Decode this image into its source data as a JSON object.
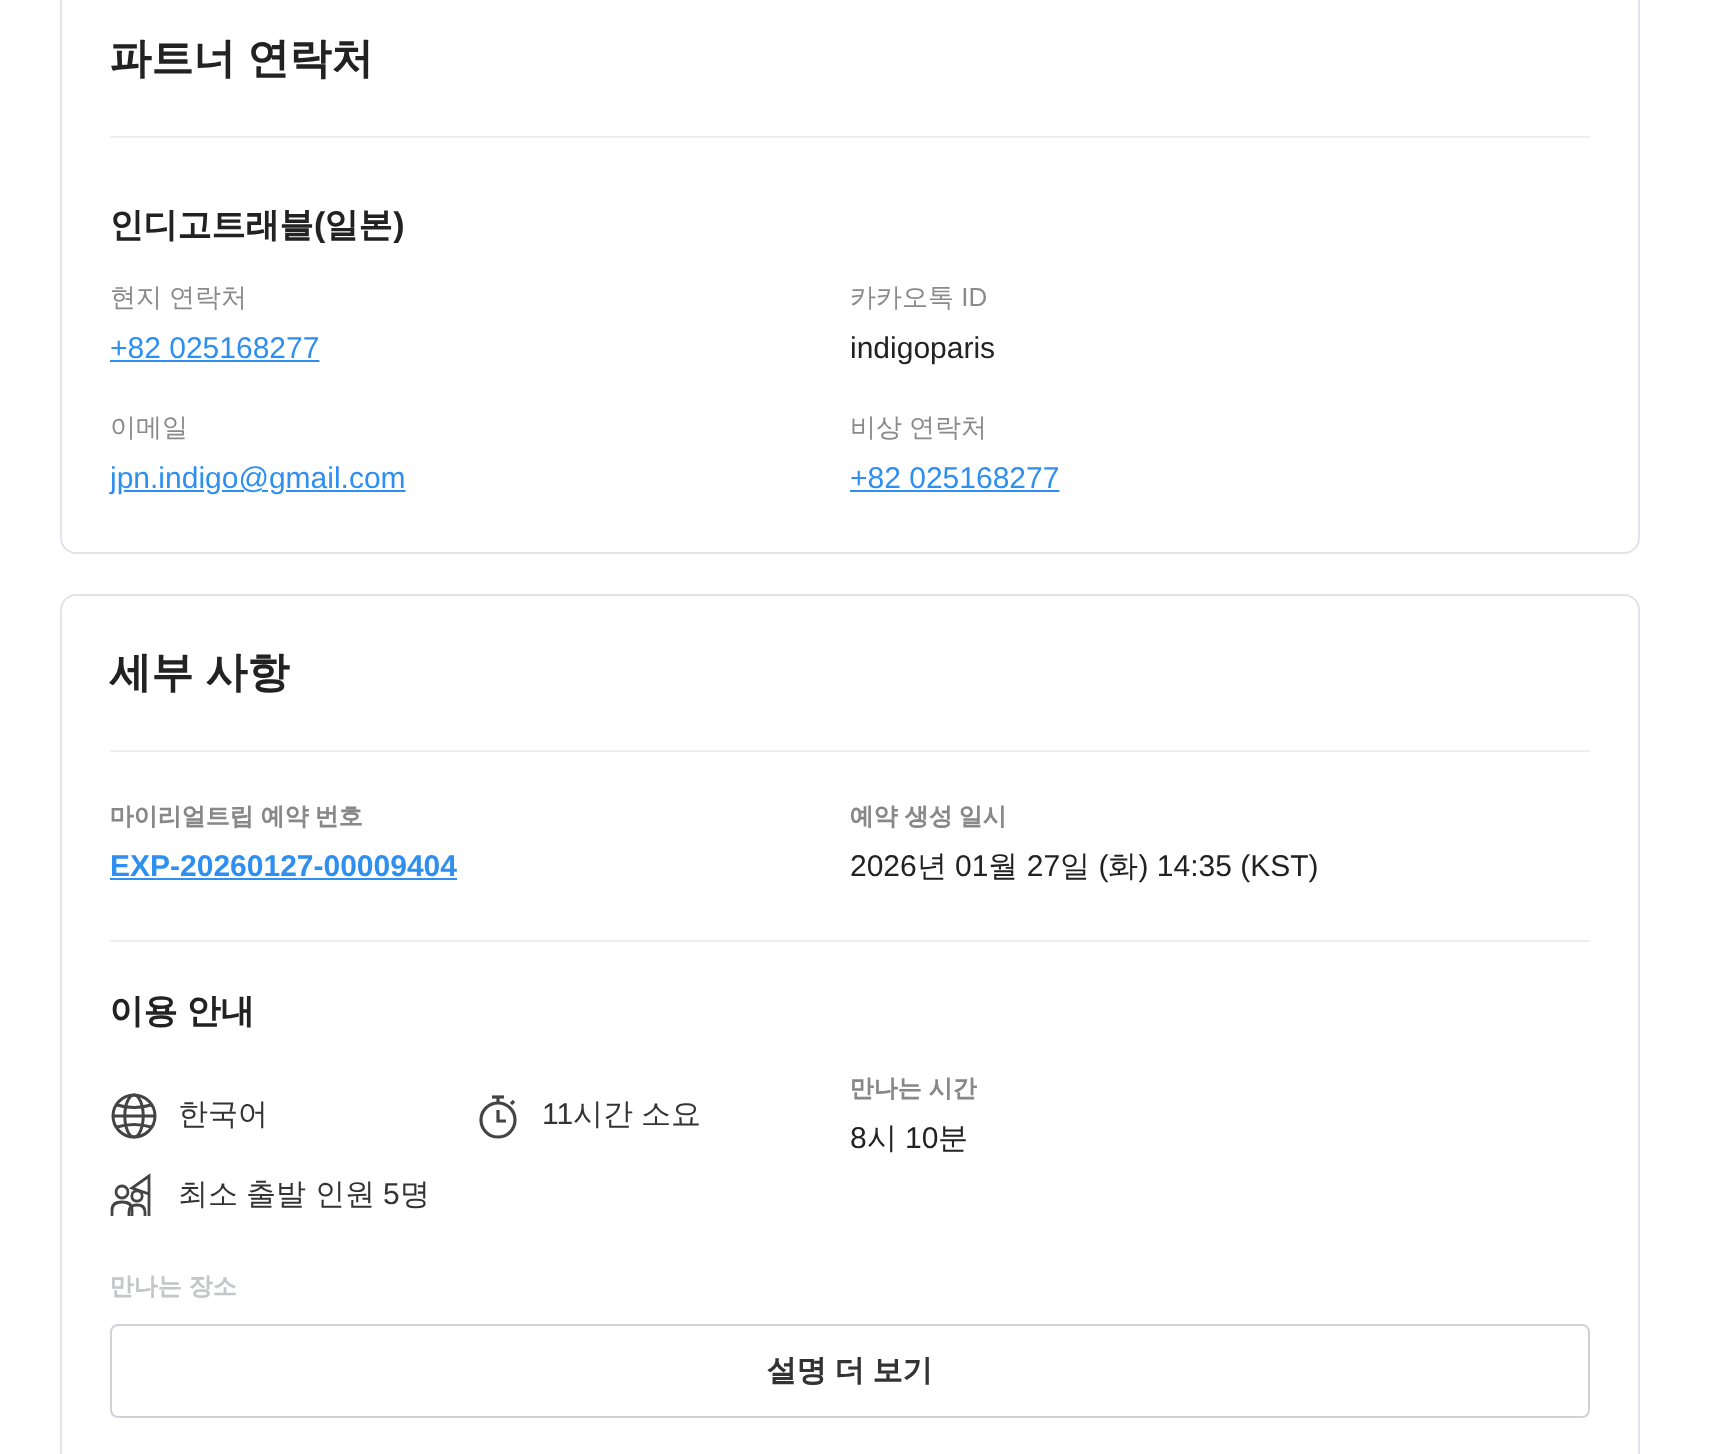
{
  "partner_contacts": {
    "title": "파트너 연락처",
    "partner_name": "인디고트래블(일본)",
    "fields": [
      {
        "label": "현지 연락처",
        "value": "+82 025168277",
        "kind": "link"
      },
      {
        "label": "카카오톡 ID",
        "value": "indigoparis",
        "kind": "text"
      },
      {
        "label": "이메일",
        "value": "jpn.indigo@gmail.com",
        "kind": "link"
      },
      {
        "label": "비상 연락처",
        "value": "+82 025168277",
        "kind": "link"
      }
    ]
  },
  "details": {
    "title": "세부 사항",
    "fields": [
      {
        "label": "마이리얼트립 예약 번호",
        "value": "EXP-20260127-00009404",
        "kind": "booking_link"
      },
      {
        "label": "예약 생성 일시",
        "value": "2026년 01월 27일 (화) 14:35 (KST)",
        "kind": "text"
      }
    ],
    "usage_guide": {
      "title": "이용 안내",
      "items": [
        {
          "kind": "language",
          "text": "한국어"
        },
        {
          "kind": "duration",
          "text": "11시간 소요"
        },
        {
          "kind": "min_people",
          "text": "최소 출발 인원 5명"
        }
      ],
      "meeting_time": {
        "label": "만나는 시간",
        "value": "8시 10분"
      },
      "meeting_place": {
        "label": "만나는 장소",
        "button": "설명 더 보기"
      }
    }
  }
}
